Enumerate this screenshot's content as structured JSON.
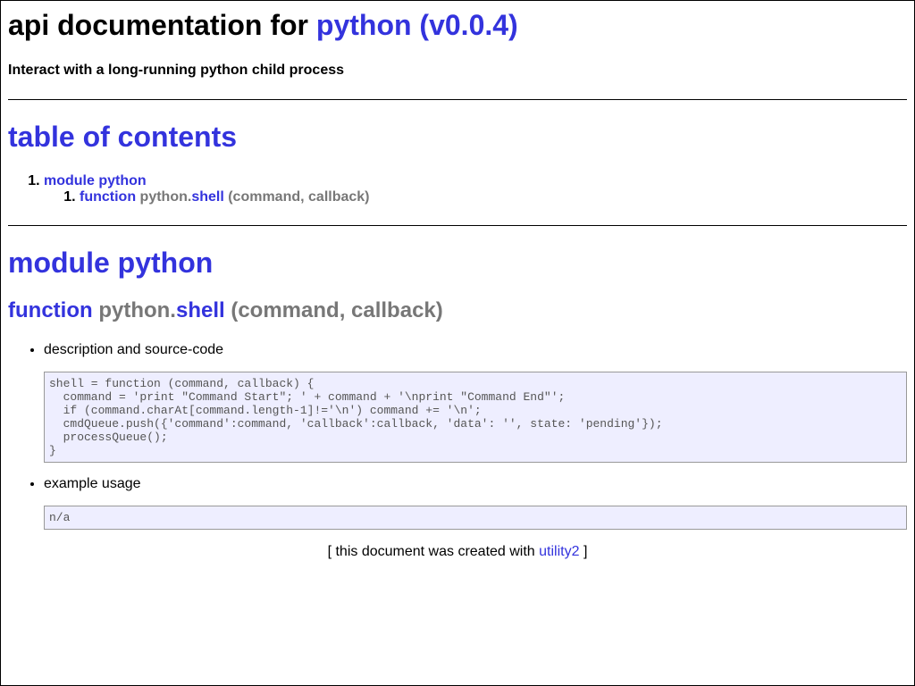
{
  "header": {
    "title_prefix": "api documentation for ",
    "title_link": "python (v0.0.4)",
    "subtitle": "Interact with a long-running python child process"
  },
  "toc": {
    "heading": "table of contents",
    "module_link": "module python",
    "function_keyword": "function",
    "function_module": "python.",
    "function_name": "shell",
    "function_signature": " (command, callback)"
  },
  "module": {
    "heading": "module python",
    "function": {
      "keyword": "function",
      "module": "python.",
      "name": "shell",
      "signature": " (command, callback)"
    },
    "details": {
      "description_label": "description and source-code",
      "source_code": "shell = function (command, callback) {\n  command = 'print \"Command Start\"; ' + command + '\\nprint \"Command End\"';\n  if (command.charAt[command.length-1]!='\\n') command += '\\n';\n  cmdQueue.push({'command':command, 'callback':callback, 'data': '', state: 'pending'});\n  processQueue();\n}",
      "example_label": "example usage",
      "example_code": "n/a"
    }
  },
  "footer": {
    "prefix": "[ this document was created with ",
    "link": "utility2",
    "suffix": " ]"
  },
  "colors": {
    "link": "#3333dd",
    "muted": "#777777",
    "code_background": "#eeeeff"
  }
}
